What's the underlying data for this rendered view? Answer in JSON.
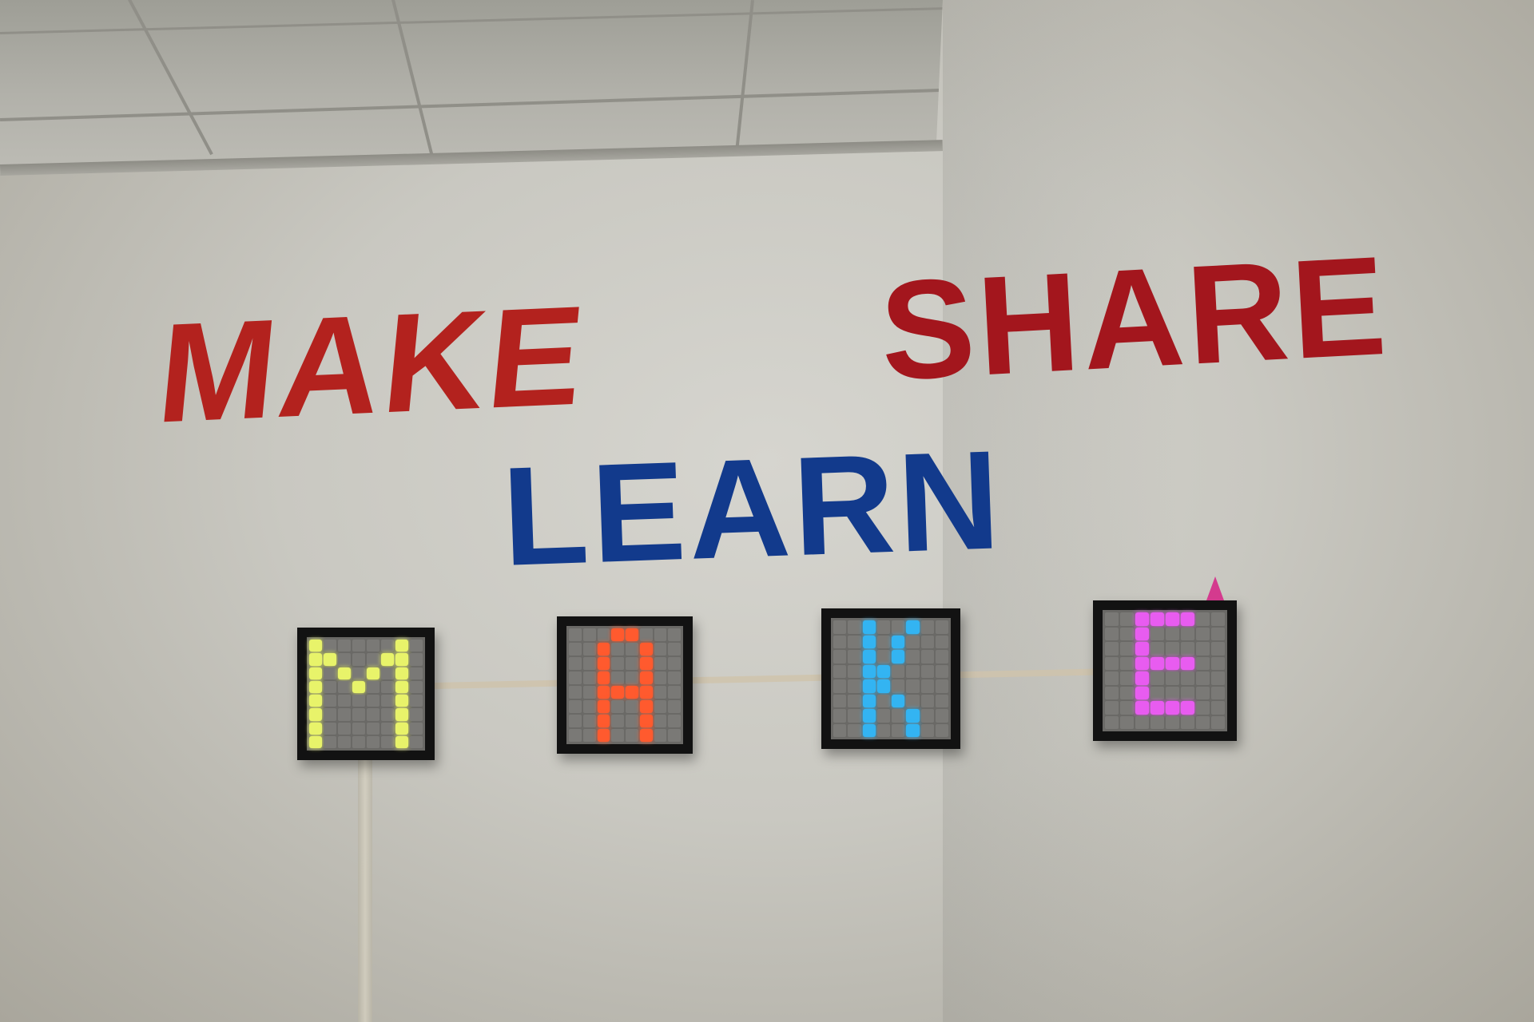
{
  "wall_text": {
    "make": "MAKE",
    "share": "SHARE",
    "learn": "LEARN"
  },
  "light_panels": [
    {
      "letter": "M",
      "color": "#e8f36a"
    },
    {
      "letter": "A",
      "color": "#ff5a2e"
    },
    {
      "letter": "K",
      "color": "#33b4f2"
    },
    {
      "letter": "E",
      "color": "#e85cf0"
    }
  ],
  "colors": {
    "make": "#b3221e",
    "share": "#a3161d",
    "learn": "#123a8c"
  }
}
